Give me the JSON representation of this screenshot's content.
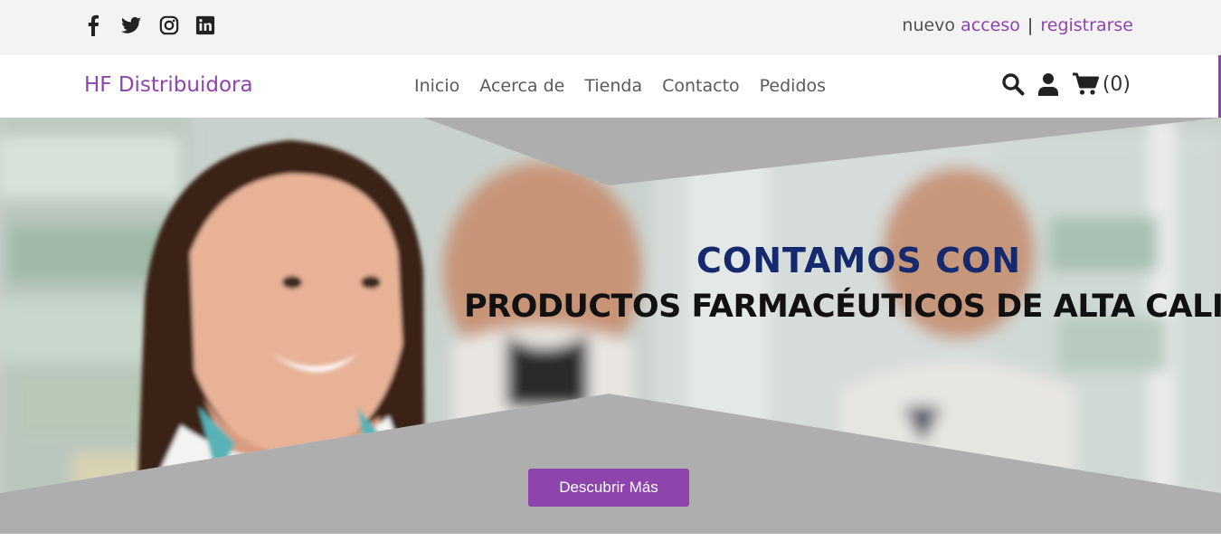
{
  "topbar": {
    "social": [
      "facebook-icon",
      "twitter-icon",
      "instagram-icon",
      "linkedin-icon"
    ],
    "auth_prefix": "nuevo",
    "login": "acceso",
    "separator": "|",
    "register": "registrarse"
  },
  "nav": {
    "brand": "HF Distribuidora",
    "links": [
      "Inicio",
      "Acerca de",
      "Tienda",
      "Contacto",
      "Pedidos"
    ],
    "icons": [
      "search-icon",
      "user-icon",
      "cart-icon"
    ],
    "cart_count": "(0)"
  },
  "hero": {
    "line1": "CONTAMOS CON",
    "line2": "PRODUCTOS FARMACÉUTICOS DE ALTA CALIDAD",
    "cta": "Descubrir Más"
  },
  "colors": {
    "accent": "#8e44ad",
    "topbar_bg": "#f3f3f3",
    "hero_overlay": "#aeaeae",
    "heading_blue": "#152a6e"
  }
}
